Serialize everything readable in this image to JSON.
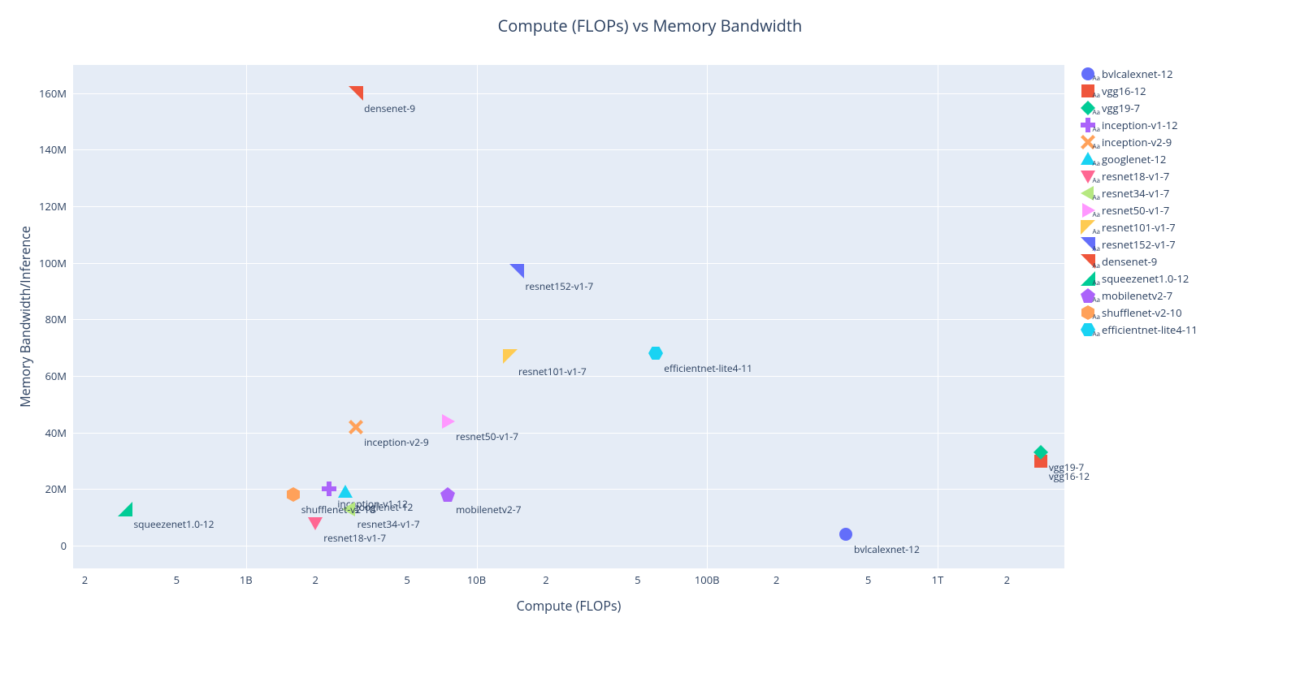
{
  "chart_data": {
    "type": "scatter",
    "title": "Compute (FLOPs) vs Memory Bandwidth",
    "xlabel": "Compute (FLOPs)",
    "ylabel": "Memory Bandwidth/Inference",
    "x_scale": "log",
    "x_ticks": [
      {
        "value": 200000000.0,
        "label": "2"
      },
      {
        "value": 500000000.0,
        "label": "5"
      },
      {
        "value": 1000000000.0,
        "label": "1B"
      },
      {
        "value": 2000000000.0,
        "label": "2"
      },
      {
        "value": 5000000000.0,
        "label": "5"
      },
      {
        "value": 10000000000.0,
        "label": "10B"
      },
      {
        "value": 20000000000.0,
        "label": "2"
      },
      {
        "value": 50000000000.0,
        "label": "5"
      },
      {
        "value": 100000000000.0,
        "label": "100B"
      },
      {
        "value": 200000000000.0,
        "label": "2"
      },
      {
        "value": 500000000000.0,
        "label": "5"
      },
      {
        "value": 1000000000000.0,
        "label": "1T"
      },
      {
        "value": 2000000000000.0,
        "label": "2"
      }
    ],
    "x_range_log10": [
      8.25,
      12.55
    ],
    "y_scale": "linear",
    "y_ticks": [
      0,
      20000000,
      40000000,
      60000000,
      80000000,
      100000000,
      120000000,
      140000000,
      160000000
    ],
    "y_tick_labels": [
      "0",
      "20M",
      "40M",
      "60M",
      "80M",
      "100M",
      "120M",
      "140M",
      "160M"
    ],
    "ylim": [
      -8000000,
      170000000
    ],
    "series": [
      {
        "name": "bvlcalexnet-12",
        "x": 400000000000.0,
        "y": 4000000,
        "color": "#636efa",
        "marker": "circle"
      },
      {
        "name": "vgg16-12",
        "x": 2800000000000.0,
        "y": 30000000,
        "color": "#ef553b",
        "marker": "square"
      },
      {
        "name": "vgg19-7",
        "x": 2800000000000.0,
        "y": 33000000,
        "color": "#00cc96",
        "marker": "diamond"
      },
      {
        "name": "inception-v1-12",
        "x": 2300000000.0,
        "y": 20000000,
        "color": "#ab63fa",
        "marker": "cross"
      },
      {
        "name": "inception-v2-9",
        "x": 3000000000.0,
        "y": 42000000,
        "color": "#ffa15a",
        "marker": "x"
      },
      {
        "name": "googlenet-12",
        "x": 2700000000.0,
        "y": 19000000,
        "color": "#19d3f3",
        "marker": "triangle-up"
      },
      {
        "name": "resnet18-v1-7",
        "x": 2000000000.0,
        "y": 8000000,
        "color": "#ff6692",
        "marker": "triangle-down"
      },
      {
        "name": "resnet34-v1-7",
        "x": 2800000000.0,
        "y": 13000000,
        "color": "#b6e880",
        "marker": "triangle-left"
      },
      {
        "name": "resnet50-v1-7",
        "x": 7500000000.0,
        "y": 44000000,
        "color": "#ff97ff",
        "marker": "triangle-right"
      },
      {
        "name": "resnet101-v1-7",
        "x": 14000000000.0,
        "y": 67000000,
        "color": "#fecb52",
        "marker": "triangle-nw"
      },
      {
        "name": "resnet152-v1-7",
        "x": 15000000000.0,
        "y": 97000000,
        "color": "#636efa",
        "marker": "triangle-ne"
      },
      {
        "name": "densenet-9",
        "x": 3000000000.0,
        "y": 160000000,
        "color": "#ef553b",
        "marker": "triangle-ne"
      },
      {
        "name": "squeezenet1.0-12",
        "x": 300000000.0,
        "y": 13000000,
        "color": "#00cc96",
        "marker": "triangle-se"
      },
      {
        "name": "mobilenetv2-7",
        "x": 7500000000.0,
        "y": 18000000,
        "color": "#ab63fa",
        "marker": "pentagon"
      },
      {
        "name": "shufflenet-v2-10",
        "x": 1600000000.0,
        "y": 18000000,
        "color": "#ffa15a",
        "marker": "hexagon"
      },
      {
        "name": "efficientnet-lite4-11",
        "x": 60000000000.0,
        "y": 68000000,
        "color": "#19d3f3",
        "marker": "hexagon2"
      }
    ]
  }
}
